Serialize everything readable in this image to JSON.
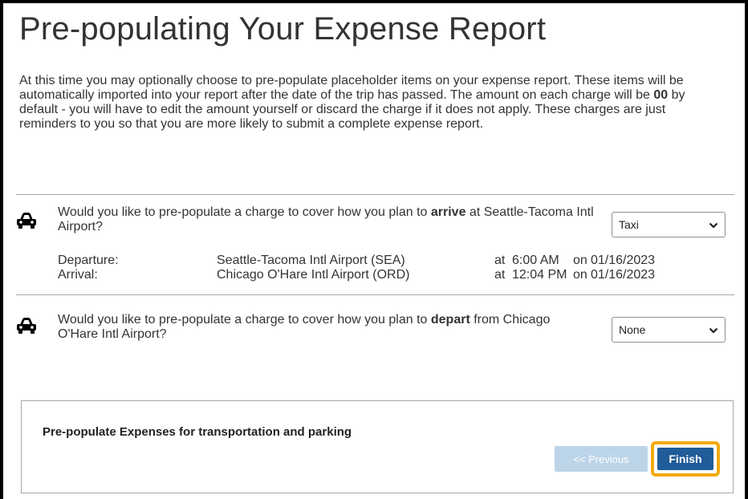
{
  "page": {
    "title": "Pre-populating Your Expense Report",
    "intro": {
      "part1": "At this time you may optionally choose to pre-populate placeholder items on your expense report. These items will be automatically imported into your report after the date of the trip has passed. The amount on each charge will be ",
      "amount": "00",
      "part2": " by default - you will have to edit the amount yourself or discard the charge if it does not apply. These charges are just reminders to you so that you are more likely to submit a complete expense report."
    }
  },
  "arrive_section": {
    "icon": "car-icon",
    "question_pre": "Would you like to pre-populate a charge to cover how you plan to ",
    "question_bold": "arrive",
    "question_post": " at Seattle-Tacoma Intl Airport?",
    "select_value": "Taxi",
    "flights": [
      {
        "label": "Departure:",
        "airport": "Seattle-Tacoma Intl Airport (SEA)",
        "at": "at",
        "time": "6:00 AM",
        "on": "on",
        "date": "01/16/2023"
      },
      {
        "label": "Arrival:",
        "airport": "Chicago O'Hare Intl Airport (ORD)",
        "at": "at",
        "time": "12:04 PM",
        "on": "on",
        "date": "01/16/2023"
      }
    ]
  },
  "depart_section": {
    "icon": "car-icon",
    "question_pre": "Would you like to pre-populate a charge to cover how you plan to ",
    "question_bold": "depart",
    "question_post": " from Chicago O'Hare Intl Airport?",
    "select_value": "None"
  },
  "footer_panel": {
    "title": "Pre-populate Expenses for transportation and parking",
    "previous_label": "<< Previous",
    "finish_label": "Finish",
    "highlight_color": "#f3a90f",
    "finish_color": "#1f5c99"
  }
}
